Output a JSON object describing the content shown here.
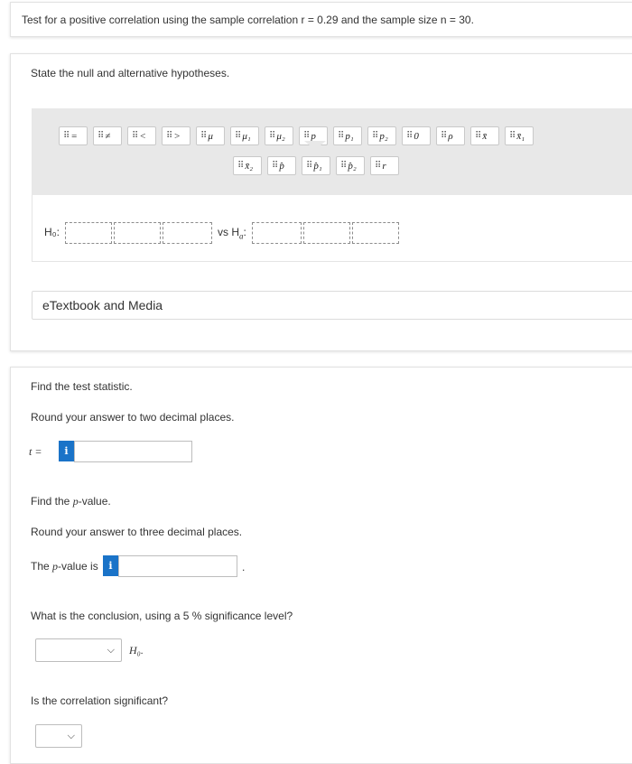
{
  "intro": {
    "text": "Test for a positive correlation using the sample correlation r = 0.29 and the sample size n = 30."
  },
  "q1": {
    "prompt": "State the null and alternative hypotheses.",
    "palette_row1": [
      "=",
      "≠",
      "<",
      ">",
      "μ",
      "μ₁",
      "μ₂",
      "p",
      "p₁",
      "p₂",
      "0",
      "ρ",
      "x̄",
      "x̄₁"
    ],
    "palette_row2": [
      "x̄₂",
      "p̂",
      "p̂₁",
      "p̂₂",
      "r"
    ],
    "h0_label": "H₀:",
    "vs_label": "vs H",
    "ha_sub": "a",
    "etextbook": "eTextbook and Media"
  },
  "q2": {
    "find_stat": "Find the test statistic.",
    "round_two": "Round your answer to two decimal places.",
    "t_label": "t =",
    "info_icon": "i",
    "find_p_a": "Find the ",
    "find_p_var": "p",
    "find_p_b": "-value.",
    "round_three": "Round your answer to three decimal places.",
    "pval_a": "The ",
    "pval_var": "p",
    "pval_b": "-value is",
    "period": ".",
    "conclusion_q": "What is the conclusion, using a 5 % significance level?",
    "h0_after": "H₀.",
    "significant_q": "Is the correlation significant?"
  }
}
